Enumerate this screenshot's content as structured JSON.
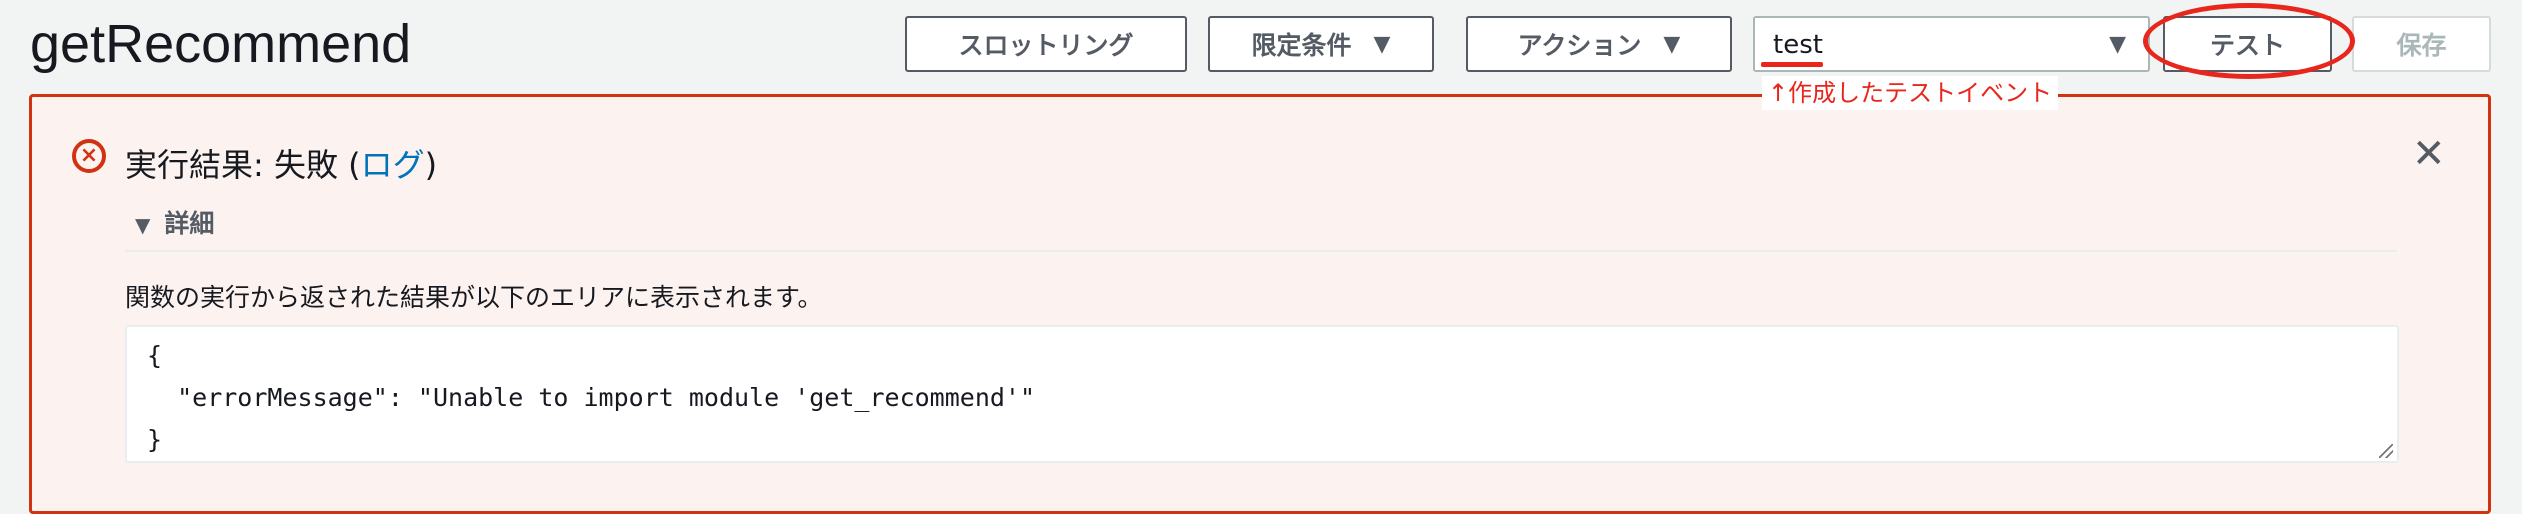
{
  "header": {
    "title": "getRecommend",
    "buttons": {
      "throttle": "スロットリング",
      "qualifiers": "限定条件",
      "actions": "アクション",
      "test": "テスト",
      "save": "保存"
    },
    "test_event_select": {
      "value": "test"
    },
    "annotation": "↑作成したテストイベント"
  },
  "alert": {
    "heading_prefix": "実行結果: 失敗 (",
    "log_link": "ログ",
    "heading_suffix": ")",
    "details_label": "詳細",
    "description": "関数の実行から返された結果が以下のエリアに表示されます。",
    "output": "{\n  \"errorMessage\": \"Unable to import module 'get_recommend'\"\n}"
  },
  "colors": {
    "error": "#d13212",
    "annotation": "#e8261c",
    "link": "#0073bb"
  }
}
